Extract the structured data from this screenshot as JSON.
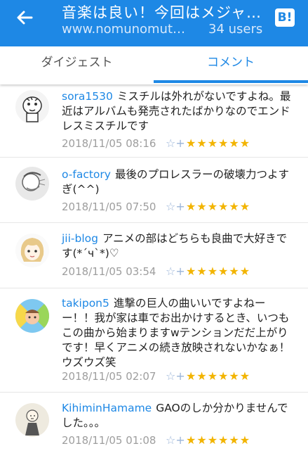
{
  "header": {
    "title": "音楽は良い！今回はメジャ…",
    "url": "www.nomunomutuk…",
    "users": "34 users",
    "hatena_logo": "B!"
  },
  "tabs": [
    {
      "label": "ダイジェスト",
      "active": false
    },
    {
      "label": "コメント",
      "active": true
    }
  ],
  "colors": {
    "accent": "#1e88e5",
    "star": "#f2b400"
  },
  "comments": [
    {
      "user": "sora1530",
      "text": "ミスチルは外れがないですよね。最近はアルバムも発売されたばかりなのでエンドレスミスチルです",
      "date": "2018/11/05 08:16",
      "add_star": "☆+",
      "stars": "★★★★★★"
    },
    {
      "user": "o-factory",
      "text": "最後のプロレスラーの破壊力つよすぎ(^^)",
      "date": "2018/11/05 07:50",
      "add_star": "☆+",
      "stars": "★★★★★★"
    },
    {
      "user": "jii-blog",
      "text": "アニメの部はどちらも良曲で大好きです(*´ч`*)♡",
      "date": "2018/11/05 03:54",
      "add_star": "☆+",
      "stars": "★★★★★★"
    },
    {
      "user": "takipon5",
      "text": "進撃の巨人の曲いいですよねーー！！我が家は車でお出かけするとき、いつもこの曲から始まりますwテンションだだ上がりです！早くアニメの続き放映されないかなぁ！ウズウズ笑",
      "date": "2018/11/05 02:07",
      "add_star": "☆+",
      "stars": "★★★★★★"
    },
    {
      "user": "KihiminHamame",
      "text": "GAOのしか分かりませんでした。。。",
      "date": "2018/11/05 01:08",
      "add_star": "☆+",
      "stars": "★★★★★★"
    }
  ]
}
